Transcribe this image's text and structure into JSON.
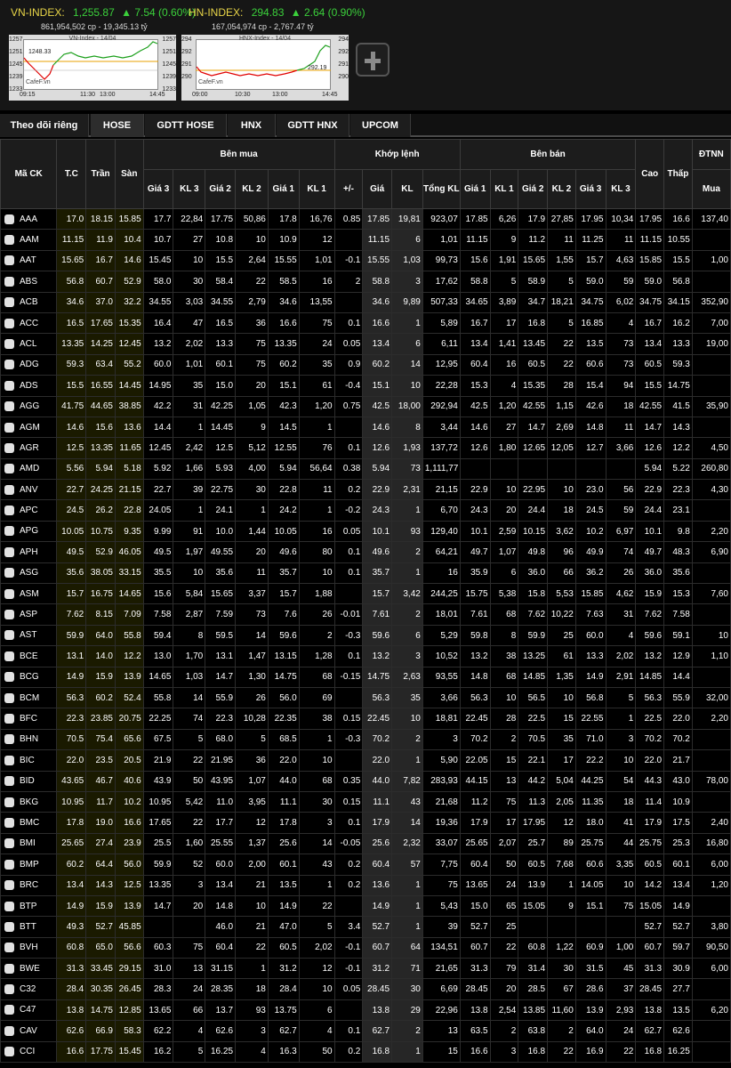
{
  "vnindex": {
    "name": "VN-INDEX:",
    "value": "1,255.87",
    "change": "7.54 (0.60%)",
    "volume": "861,954,502 cp - 19,345.13 tỷ",
    "chart_title": "VN-Index - 14/04",
    "y_left": [
      "1257",
      "1251",
      "1245",
      "1239",
      "1233"
    ],
    "y_right": [
      "1257",
      "1251",
      "1245",
      "1239",
      "1233"
    ],
    "times": [
      "09:15",
      "11:30",
      "13:00",
      "14:45"
    ],
    "current": "1248.33",
    "logo": "CafeF.vn"
  },
  "hnxindex": {
    "name": "HN-INDEX:",
    "value": "294.83",
    "change": "2.64 (0.90%)",
    "volume": "167,054,974 cp - 2,767.47 tỷ",
    "chart_title": "HNX-Index - 14/04",
    "y_left": [
      "294",
      "292",
      "291",
      "290"
    ],
    "y_right": [
      "294",
      "292",
      "291",
      "290"
    ],
    "times": [
      "09:00",
      "10:30",
      "13:00",
      "14:45"
    ],
    "current": "292.19",
    "logo": "CafeF.vn"
  },
  "add_label": "+",
  "tabs": [
    "Theo dõi riêng",
    "HOSE",
    "GDTT HOSE",
    "HNX",
    "GDTT HNX",
    "UPCOM"
  ],
  "headers": {
    "symbol": "Mã CK",
    "tc": "T.C",
    "tran": "Trần",
    "san": "Sàn",
    "ben_mua": "Bên mua",
    "khop_lenh": "Khớp lệnh",
    "ben_ban": "Bên bán",
    "cao": "Cao",
    "thap": "Thấp",
    "dtnn": "ĐTNN",
    "mua": "Mua",
    "g3": "Giá 3",
    "k3": "KL 3",
    "g2": "Giá 2",
    "k2": "KL 2",
    "g1": "Giá 1",
    "k1": "KL 1",
    "pm": "+/-",
    "gia": "Giá",
    "kl": "KL",
    "tong": "Tổng KL",
    "sg1": "Giá 1",
    "sk1": "KL 1",
    "sg2": "Giá 2",
    "sk2": "KL 2",
    "sg3": "Giá 3",
    "sk3": "KL 3"
  },
  "rows": [
    [
      "AAA",
      "17.0",
      "18.15",
      "15.85",
      "17.7",
      "22,84",
      "17.75",
      "50,86",
      "17.8",
      "16,76",
      "0.85",
      "17.85",
      "19,81",
      "923,07",
      "17.85",
      "6,26",
      "17.9",
      "27,85",
      "17.95",
      "10,34",
      "17.95",
      "16.6",
      "137,40",
      "u"
    ],
    [
      "AAM",
      "11.15",
      "11.9",
      "10.4",
      "10.7",
      "27",
      "10.8",
      "10",
      "10.9",
      "12",
      "",
      "11.15",
      "6",
      "1,01",
      "11.15",
      "9",
      "11.2",
      "11",
      "11.25",
      "11",
      "11.15",
      "10.55",
      "",
      "r"
    ],
    [
      "AAT",
      "15.65",
      "16.7",
      "14.6",
      "15.45",
      "10",
      "15.5",
      "2,64",
      "15.55",
      "1,01",
      "-0.1",
      "15.55",
      "1,03",
      "99,73",
      "15.6",
      "1,91",
      "15.65",
      "1,55",
      "15.7",
      "4,63",
      "15.85",
      "15.5",
      "1,00",
      "d"
    ],
    [
      "ABS",
      "56.8",
      "60.7",
      "52.9",
      "58.0",
      "30",
      "58.4",
      "22",
      "58.5",
      "16",
      "2",
      "58.8",
      "3",
      "17,62",
      "58.8",
      "5",
      "58.9",
      "5",
      "59.0",
      "59",
      "59.0",
      "56.8",
      "",
      "u"
    ],
    [
      "ACB",
      "34.6",
      "37.0",
      "32.2",
      "34.55",
      "3,03",
      "34.55",
      "2,79",
      "34.6",
      "13,55",
      "",
      "34.6",
      "9,89",
      "507,33",
      "34.65",
      "3,89",
      "34.7",
      "18,21",
      "34.75",
      "6,02",
      "34.75",
      "34.15",
      "352,90",
      "r"
    ],
    [
      "ACC",
      "16.5",
      "17.65",
      "15.35",
      "16.4",
      "47",
      "16.5",
      "36",
      "16.6",
      "75",
      "0.1",
      "16.6",
      "1",
      "5,89",
      "16.7",
      "17",
      "16.8",
      "5",
      "16.85",
      "4",
      "16.7",
      "16.2",
      "7,00",
      "u"
    ],
    [
      "ACL",
      "13.35",
      "14.25",
      "12.45",
      "13.2",
      "2,02",
      "13.3",
      "75",
      "13.35",
      "24",
      "0.05",
      "13.4",
      "6",
      "6,11",
      "13.4",
      "1,41",
      "13.45",
      "22",
      "13.5",
      "73",
      "13.4",
      "13.3",
      "19,00",
      "u"
    ],
    [
      "ADG",
      "59.3",
      "63.4",
      "55.2",
      "60.0",
      "1,01",
      "60.1",
      "75",
      "60.2",
      "35",
      "0.9",
      "60.2",
      "14",
      "12,95",
      "60.4",
      "16",
      "60.5",
      "22",
      "60.6",
      "73",
      "60.5",
      "59.3",
      "",
      "u"
    ],
    [
      "ADS",
      "15.5",
      "16.55",
      "14.45",
      "14.95",
      "35",
      "15.0",
      "20",
      "15.1",
      "61",
      "-0.4",
      "15.1",
      "10",
      "22,28",
      "15.3",
      "4",
      "15.35",
      "28",
      "15.4",
      "94",
      "15.5",
      "14.75",
      "",
      "d"
    ],
    [
      "AGG",
      "41.75",
      "44.65",
      "38.85",
      "42.2",
      "31",
      "42.25",
      "1,05",
      "42.3",
      "1,20",
      "0.75",
      "42.5",
      "18,00",
      "292,94",
      "42.5",
      "1,20",
      "42.55",
      "1,15",
      "42.6",
      "18",
      "42.55",
      "41.5",
      "35,90",
      "u"
    ],
    [
      "AGM",
      "14.6",
      "15.6",
      "13.6",
      "14.4",
      "1",
      "14.45",
      "9",
      "14.5",
      "1",
      "",
      "14.6",
      "8",
      "3,44",
      "14.6",
      "27",
      "14.7",
      "2,69",
      "14.8",
      "11",
      "14.7",
      "14.3",
      "",
      "r"
    ],
    [
      "AGR",
      "12.5",
      "13.35",
      "11.65",
      "12.45",
      "2,42",
      "12.5",
      "5,12",
      "12.55",
      "76",
      "0.1",
      "12.6",
      "1,93",
      "137,72",
      "12.6",
      "1,80",
      "12.65",
      "12,05",
      "12.7",
      "3,66",
      "12.6",
      "12.2",
      "4,50",
      "u"
    ],
    [
      "AMD",
      "5.56",
      "5.94",
      "5.18",
      "5.92",
      "1,66",
      "5.93",
      "4,00",
      "5.94",
      "56,64",
      "0.38",
      "5.94",
      "73",
      "1,111,77",
      "",
      "",
      "",
      "",
      "",
      "",
      "5.94",
      "5.22",
      "260,80",
      "c"
    ],
    [
      "ANV",
      "22.7",
      "24.25",
      "21.15",
      "22.7",
      "39",
      "22.75",
      "30",
      "22.8",
      "11",
      "0.2",
      "22.9",
      "2,31",
      "21,15",
      "22.9",
      "10",
      "22.95",
      "10",
      "23.0",
      "56",
      "22.9",
      "22.3",
      "4,30",
      "u"
    ],
    [
      "APC",
      "24.5",
      "26.2",
      "22.8",
      "24.05",
      "1",
      "24.1",
      "1",
      "24.2",
      "1",
      "-0.2",
      "24.3",
      "1",
      "6,70",
      "24.3",
      "20",
      "24.4",
      "18",
      "24.5",
      "59",
      "24.4",
      "23.1",
      "",
      "d"
    ],
    [
      "APG",
      "10.05",
      "10.75",
      "9.35",
      "9.99",
      "91",
      "10.0",
      "1,44",
      "10.05",
      "16",
      "0.05",
      "10.1",
      "93",
      "129,40",
      "10.1",
      "2,59",
      "10.15",
      "3,62",
      "10.2",
      "6,97",
      "10.1",
      "9.8",
      "2,20",
      "u"
    ],
    [
      "APH",
      "49.5",
      "52.9",
      "46.05",
      "49.5",
      "1,97",
      "49.55",
      "20",
      "49.6",
      "80",
      "0.1",
      "49.6",
      "2",
      "64,21",
      "49.7",
      "1,07",
      "49.8",
      "96",
      "49.9",
      "74",
      "49.7",
      "48.3",
      "6,90",
      "u"
    ],
    [
      "ASG",
      "35.6",
      "38.05",
      "33.15",
      "35.5",
      "10",
      "35.6",
      "11",
      "35.7",
      "10",
      "0.1",
      "35.7",
      "1",
      "16",
      "35.9",
      "6",
      "36.0",
      "66",
      "36.2",
      "26",
      "36.0",
      "35.6",
      "",
      "u"
    ],
    [
      "ASM",
      "15.7",
      "16.75",
      "14.65",
      "15.6",
      "5,84",
      "15.65",
      "3,37",
      "15.7",
      "1,88",
      "",
      "15.7",
      "3,42",
      "244,25",
      "15.75",
      "5,38",
      "15.8",
      "5,53",
      "15.85",
      "4,62",
      "15.9",
      "15.3",
      "7,60",
      "r"
    ],
    [
      "ASP",
      "7.62",
      "8.15",
      "7.09",
      "7.58",
      "2,87",
      "7.59",
      "73",
      "7.6",
      "26",
      "-0.01",
      "7.61",
      "2",
      "18,01",
      "7.61",
      "68",
      "7.62",
      "10,22",
      "7.63",
      "31",
      "7.62",
      "7.58",
      "",
      "d"
    ],
    [
      "AST",
      "59.9",
      "64.0",
      "55.8",
      "59.4",
      "8",
      "59.5",
      "14",
      "59.6",
      "2",
      "-0.3",
      "59.6",
      "6",
      "5,29",
      "59.8",
      "8",
      "59.9",
      "25",
      "60.0",
      "4",
      "59.6",
      "59.1",
      "10",
      "d"
    ],
    [
      "BCE",
      "13.1",
      "14.0",
      "12.2",
      "13.0",
      "1,70",
      "13.1",
      "1,47",
      "13.15",
      "1,28",
      "0.1",
      "13.2",
      "3",
      "10,52",
      "13.2",
      "38",
      "13.25",
      "61",
      "13.3",
      "2,02",
      "13.2",
      "12.9",
      "1,10",
      "u"
    ],
    [
      "BCG",
      "14.9",
      "15.9",
      "13.9",
      "14.65",
      "1,03",
      "14.7",
      "1,30",
      "14.75",
      "68",
      "-0.15",
      "14.75",
      "2,63",
      "93,55",
      "14.8",
      "68",
      "14.85",
      "1,35",
      "14.9",
      "2,91",
      "14.85",
      "14.4",
      "",
      "d"
    ],
    [
      "BCM",
      "56.3",
      "60.2",
      "52.4",
      "55.8",
      "14",
      "55.9",
      "26",
      "56.0",
      "69",
      "",
      "56.3",
      "35",
      "3,66",
      "56.3",
      "10",
      "56.5",
      "10",
      "56.8",
      "5",
      "56.3",
      "55.9",
      "32,00",
      "r"
    ],
    [
      "BFC",
      "22.3",
      "23.85",
      "20.75",
      "22.25",
      "74",
      "22.3",
      "10,28",
      "22.35",
      "38",
      "0.15",
      "22.45",
      "10",
      "18,81",
      "22.45",
      "28",
      "22.5",
      "15",
      "22.55",
      "1",
      "22.5",
      "22.0",
      "2,20",
      "u"
    ],
    [
      "BHN",
      "70.5",
      "75.4",
      "65.6",
      "67.5",
      "5",
      "68.0",
      "5",
      "68.5",
      "1",
      "-0.3",
      "70.2",
      "2",
      "3",
      "70.2",
      "2",
      "70.5",
      "35",
      "71.0",
      "3",
      "70.2",
      "70.2",
      "",
      "d"
    ],
    [
      "BIC",
      "22.0",
      "23.5",
      "20.5",
      "21.9",
      "22",
      "21.95",
      "36",
      "22.0",
      "10",
      "",
      "22.0",
      "1",
      "5,90",
      "22.05",
      "15",
      "22.1",
      "17",
      "22.2",
      "10",
      "22.0",
      "21.7",
      "",
      "r"
    ],
    [
      "BID",
      "43.65",
      "46.7",
      "40.6",
      "43.9",
      "50",
      "43.95",
      "1,07",
      "44.0",
      "68",
      "0.35",
      "44.0",
      "7,82",
      "283,93",
      "44.15",
      "13",
      "44.2",
      "5,04",
      "44.25",
      "54",
      "44.3",
      "43.0",
      "78,00",
      "u"
    ],
    [
      "BKG",
      "10.95",
      "11.7",
      "10.2",
      "10.95",
      "5,42",
      "11.0",
      "3,95",
      "11.1",
      "30",
      "0.15",
      "11.1",
      "43",
      "21,68",
      "11.2",
      "75",
      "11.3",
      "2,05",
      "11.35",
      "18",
      "11.4",
      "10.9",
      "",
      "u"
    ],
    [
      "BMC",
      "17.8",
      "19.0",
      "16.6",
      "17.65",
      "22",
      "17.7",
      "12",
      "17.8",
      "3",
      "0.1",
      "17.9",
      "14",
      "19,36",
      "17.9",
      "17",
      "17.95",
      "12",
      "18.0",
      "41",
      "17.9",
      "17.5",
      "2,40",
      "u"
    ],
    [
      "BMI",
      "25.65",
      "27.4",
      "23.9",
      "25.5",
      "1,60",
      "25.55",
      "1,37",
      "25.6",
      "14",
      "-0.05",
      "25.6",
      "2,32",
      "33,07",
      "25.65",
      "2,07",
      "25.7",
      "89",
      "25.75",
      "44",
      "25.75",
      "25.3",
      "16,80",
      "d"
    ],
    [
      "BMP",
      "60.2",
      "64.4",
      "56.0",
      "59.9",
      "52",
      "60.0",
      "2,00",
      "60.1",
      "43",
      "0.2",
      "60.4",
      "57",
      "7,75",
      "60.4",
      "50",
      "60.5",
      "7,68",
      "60.6",
      "3,35",
      "60.5",
      "60.1",
      "6,00",
      "u"
    ],
    [
      "BRC",
      "13.4",
      "14.3",
      "12.5",
      "13.35",
      "3",
      "13.4",
      "21",
      "13.5",
      "1",
      "0.2",
      "13.6",
      "1",
      "75",
      "13.65",
      "24",
      "13.9",
      "1",
      "14.05",
      "10",
      "14.2",
      "13.4",
      "1,20",
      "u"
    ],
    [
      "BTP",
      "14.9",
      "15.9",
      "13.9",
      "14.7",
      "20",
      "14.8",
      "10",
      "14.9",
      "22",
      "",
      "14.9",
      "1",
      "5,43",
      "15.0",
      "65",
      "15.05",
      "9",
      "15.1",
      "75",
      "15.05",
      "14.9",
      "",
      "r"
    ],
    [
      "BTT",
      "49.3",
      "52.7",
      "45.85",
      "",
      "",
      "46.0",
      "21",
      "47.0",
      "5",
      "3.4",
      "52.7",
      "1",
      "39",
      "52.7",
      "25",
      "",
      "",
      "",
      "",
      "52.7",
      "52.7",
      "3,80",
      "c"
    ],
    [
      "BVH",
      "60.8",
      "65.0",
      "56.6",
      "60.3",
      "75",
      "60.4",
      "22",
      "60.5",
      "2,02",
      "-0.1",
      "60.7",
      "64",
      "134,51",
      "60.7",
      "22",
      "60.8",
      "1,22",
      "60.9",
      "1,00",
      "60.7",
      "59.7",
      "90,50",
      "d"
    ],
    [
      "BWE",
      "31.3",
      "33.45",
      "29.15",
      "31.0",
      "13",
      "31.15",
      "1",
      "31.2",
      "12",
      "-0.1",
      "31.2",
      "71",
      "21,65",
      "31.3",
      "79",
      "31.4",
      "30",
      "31.5",
      "45",
      "31.3",
      "30.9",
      "6,00",
      "d"
    ],
    [
      "C32",
      "28.4",
      "30.35",
      "26.45",
      "28.3",
      "24",
      "28.35",
      "18",
      "28.4",
      "10",
      "0.05",
      "28.45",
      "30",
      "6,69",
      "28.45",
      "20",
      "28.5",
      "67",
      "28.6",
      "37",
      "28.45",
      "27.7",
      "",
      "u"
    ],
    [
      "C47",
      "13.8",
      "14.75",
      "12.85",
      "13.65",
      "66",
      "13.7",
      "93",
      "13.75",
      "6",
      "",
      "13.8",
      "29",
      "22,96",
      "13.8",
      "2,54",
      "13.85",
      "11,60",
      "13.9",
      "2,93",
      "13.8",
      "13.5",
      "6,20",
      "r"
    ],
    [
      "CAV",
      "62.6",
      "66.9",
      "58.3",
      "62.2",
      "4",
      "62.6",
      "3",
      "62.7",
      "4",
      "0.1",
      "62.7",
      "2",
      "13",
      "63.5",
      "2",
      "63.8",
      "2",
      "64.0",
      "24",
      "62.7",
      "62.6",
      "",
      "u"
    ],
    [
      "CCI",
      "16.6",
      "17.75",
      "15.45",
      "16.2",
      "5",
      "16.25",
      "4",
      "16.3",
      "50",
      "0.2",
      "16.8",
      "1",
      "15",
      "16.6",
      "3",
      "16.8",
      "22",
      "16.9",
      "22",
      "16.8",
      "16.25",
      "",
      "u"
    ]
  ]
}
